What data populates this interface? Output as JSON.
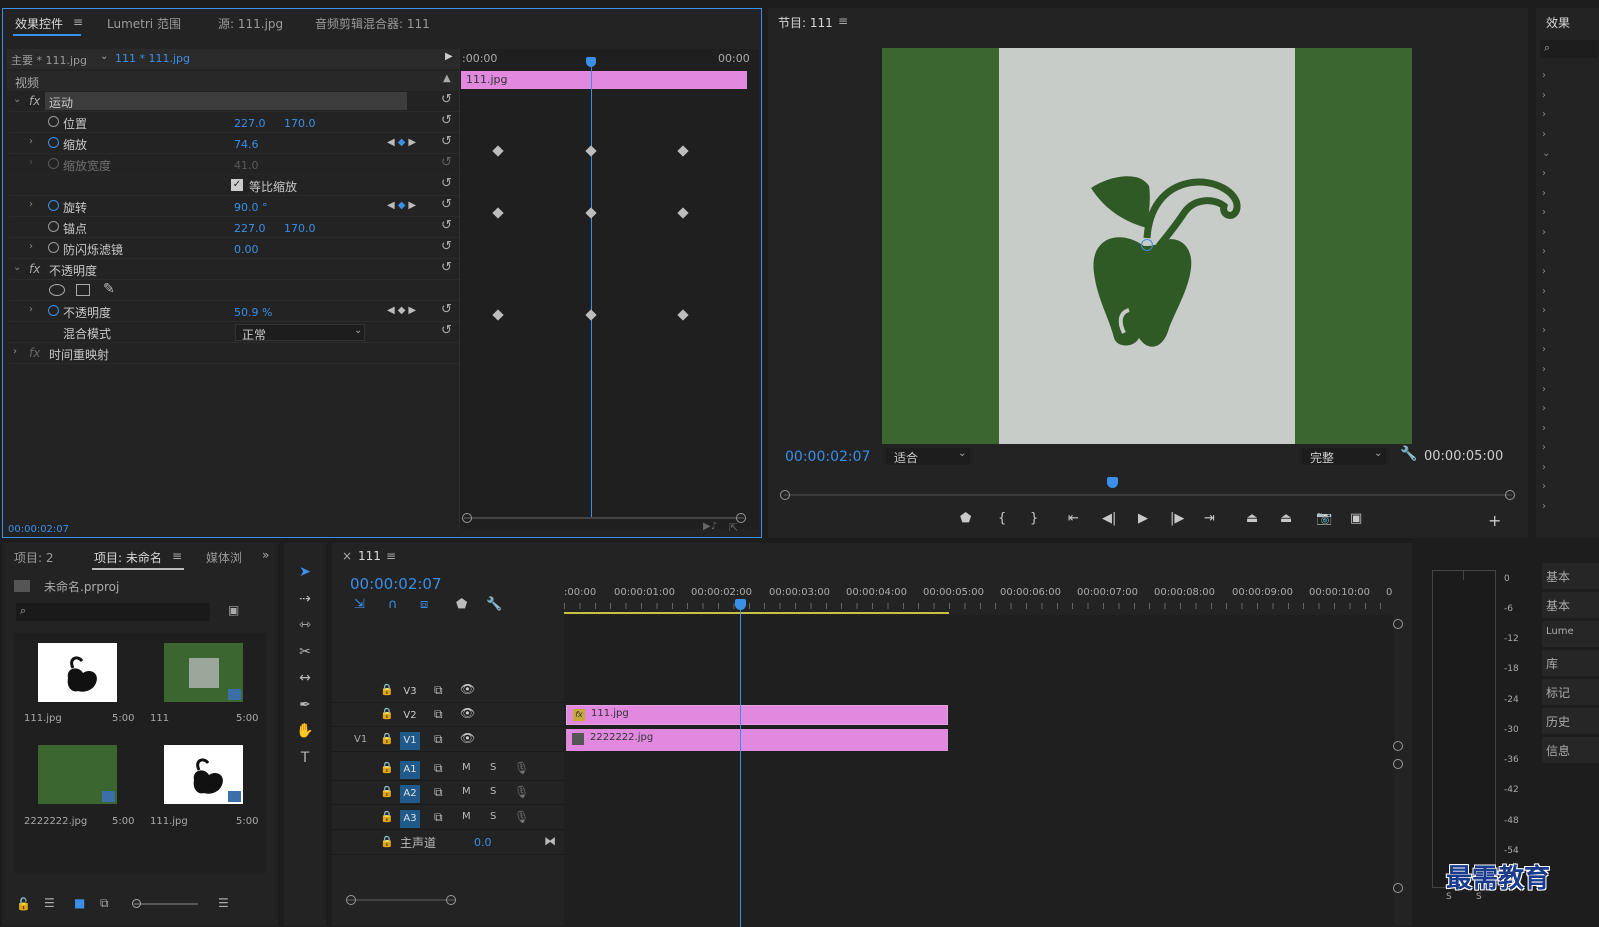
{
  "effect_controls": {
    "tabs": [
      "效果控件",
      "Lumetri 范围",
      "源: 111.jpg",
      "音频剪辑混合器: 111"
    ],
    "master_label": "主要 * 111.jpg",
    "clip_label": "111 * 111.jpg",
    "timeline_start": ":00:00",
    "timeline_end": "00:00",
    "clip_bar_label": "111.jpg",
    "section_video": "视频",
    "rows": [
      {
        "name": "运动",
        "type": "fx-group"
      },
      {
        "name": "位置",
        "v1": "227.0",
        "v2": "170.0"
      },
      {
        "name": "缩放",
        "v1": "74.6"
      },
      {
        "name": "缩放宽度",
        "v1": "41.0"
      },
      {
        "name": "等比缩放",
        "type": "checkbox",
        "checked": true
      },
      {
        "name": "旋转",
        "v1": "90.0 °"
      },
      {
        "name": "锚点",
        "v1": "227.0",
        "v2": "170.0"
      },
      {
        "name": "防闪烁滤镜",
        "v1": "0.00"
      },
      {
        "name": "不透明度",
        "type": "fx-group"
      },
      {
        "name": "不透明度",
        "v1": "50.9 %"
      },
      {
        "name": "混合模式",
        "v1": "正常"
      },
      {
        "name": "时间重映射",
        "type": "fx-group"
      }
    ],
    "timecode": "00:00:02:07"
  },
  "program_monitor": {
    "title": "节目: 111",
    "timecode": "00:00:02:07",
    "fit_label": "适合",
    "quality_label": "完整",
    "duration": "00:00:05:00"
  },
  "project": {
    "tabs": [
      "项目: 2",
      "项目: 未命名",
      "媒体浏"
    ],
    "filename": "未命名.prproj",
    "search_placeholder": "",
    "items": [
      {
        "name": "111.jpg",
        "duration": "5:00"
      },
      {
        "name": "111",
        "duration": "5:00"
      },
      {
        "name": "2222222.jpg",
        "duration": "5:00"
      },
      {
        "name": "111.jpg",
        "duration": "5:00"
      }
    ]
  },
  "timeline": {
    "tab_label": "111",
    "timecode": "00:00:02:07",
    "ruler": [
      ":00:00",
      "00:00:01:00",
      "00:00:02:00",
      "00:00:03:00",
      "00:00:04:00",
      "00:00:05:00",
      "00:00:06:00",
      "00:00:07:00",
      "00:00:08:00",
      "00:00:09:00",
      "00:00:10:00",
      "0"
    ],
    "video_tracks": [
      "V3",
      "V2",
      "V1"
    ],
    "v1_source_label": "V1",
    "audio_tracks": [
      "A1",
      "A2",
      "A3"
    ],
    "mute": "M",
    "solo": "S",
    "master_label": "主声道",
    "master_value": "0.0",
    "clips": [
      {
        "track": "V2",
        "label": "111.jpg",
        "badge": "fx"
      },
      {
        "track": "V1",
        "label": "2222222.jpg"
      }
    ]
  },
  "meter_scale": [
    "0",
    "-6",
    "-12",
    "-18",
    "-24",
    "-30",
    "-36",
    "-42",
    "-48",
    "-54"
  ],
  "meter_labels": [
    "S",
    "S"
  ],
  "right_panel": {
    "title": "效果",
    "items": [
      "基本",
      "基本",
      "Lume",
      "库",
      "标记",
      "历史",
      "信息"
    ]
  },
  "watermark": "最需教育",
  "colors": {
    "accent": "#3a8fe8",
    "clip_pink": "#e089df",
    "frame_green": "#3b6630",
    "frame_gray": "#c8ccc8"
  }
}
